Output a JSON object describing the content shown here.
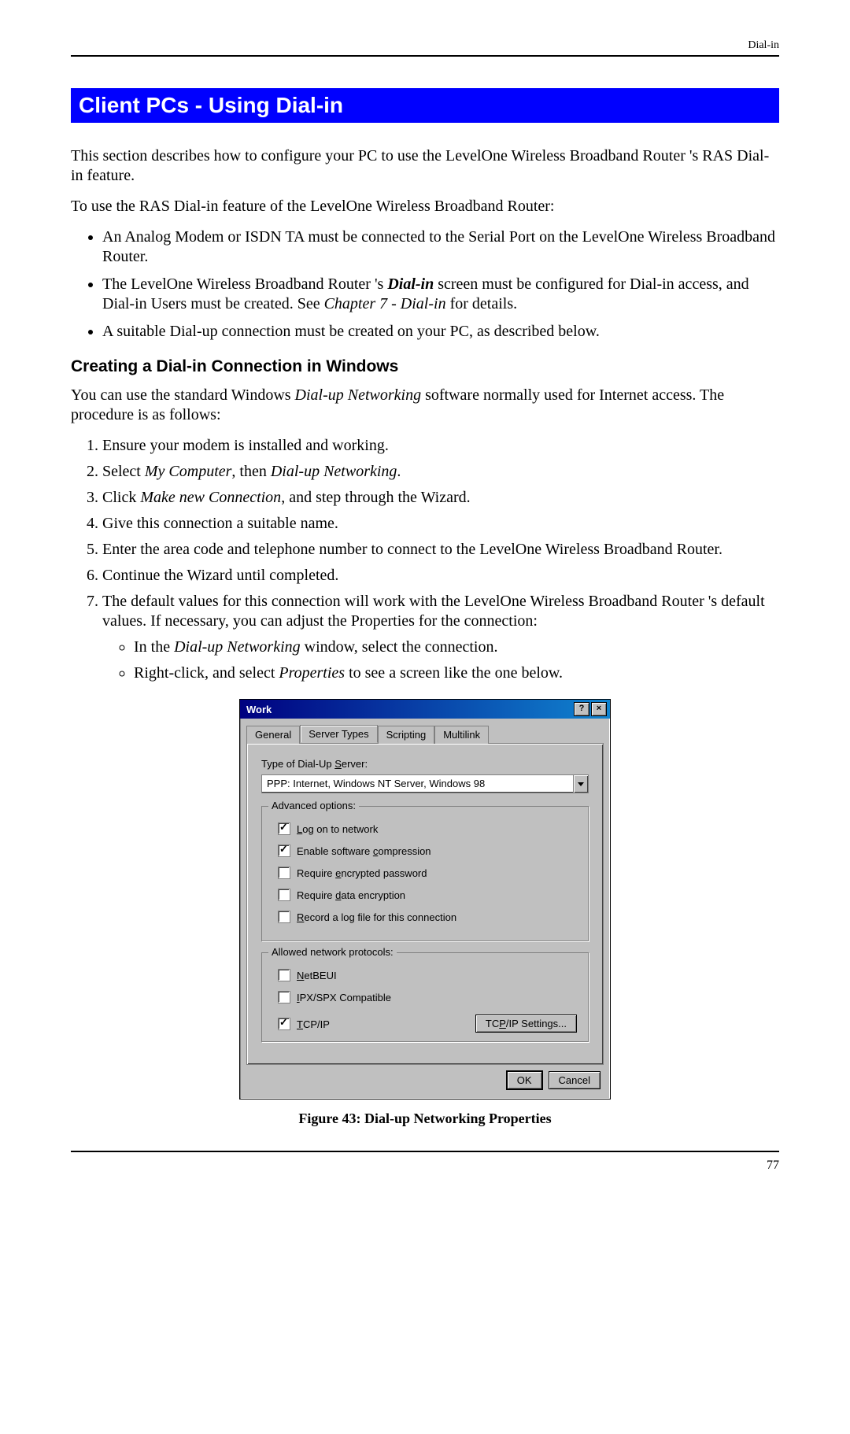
{
  "header": {
    "label": "Dial-in"
  },
  "banner": "Client PCs - Using Dial-in",
  "intro": {
    "p1": "This section describes how to configure your PC to use the LevelOne Wireless Broadband Router 's RAS Dial-in feature.",
    "p2": "To use the RAS Dial-in feature of the LevelOne Wireless Broadband Router:"
  },
  "bullets": {
    "b1": "An Analog Modem or ISDN TA must be connected to the Serial Port on the LevelOne Wireless Broadband Router.",
    "b2a": "The LevelOne Wireless Broadband Router 's ",
    "b2b": "Dial-in",
    "b2c": " screen must be configured for Dial-in access, and Dial-in Users must be created. See ",
    "b2d": "Chapter 7 - Dial-in",
    "b2e": " for details.",
    "b3": "A suitable Dial-up connection must be created on your PC, as described below."
  },
  "subheading": "Creating a Dial-in Connection in Windows",
  "subintro_a": "You can use the standard Windows ",
  "subintro_b": "Dial-up Networking",
  "subintro_c": " software normally used for Internet access. The procedure is as follows:",
  "steps": {
    "s1": "Ensure your modem is installed and working.",
    "s2a": "Select ",
    "s2b": "My Computer",
    "s2c": ", then ",
    "s2d": "Dial-up Networking",
    "s2e": ".",
    "s3a": "Click ",
    "s3b": "Make new Connection",
    "s3c": ", and step through the Wizard.",
    "s4": "Give this connection a suitable name.",
    "s5": "Enter the area code and telephone number to connect to the LevelOne Wireless Broadband Router.",
    "s6": "Continue the Wizard until completed.",
    "s7": "The default values for this connection will work with the LevelOne Wireless Broadband Router 's default values. If necessary, you can adjust the Properties for the connection:",
    "s7_sub1a": "In the ",
    "s7_sub1b": "Dial-up Networking",
    "s7_sub1c": " window, select the connection.",
    "s7_sub2a": "Right-click, and select ",
    "s7_sub2b": "Properties",
    "s7_sub2c": " to see a screen like the one below."
  },
  "dialog": {
    "title": "Work",
    "tabs": {
      "general": "General",
      "server_types": "Server Types",
      "scripting": "Scripting",
      "multilink": "Multilink"
    },
    "field_label": "Type of Dial-Up Server:",
    "combo_value": "PPP: Internet, Windows NT Server, Windows 98",
    "group_adv": "Advanced options:",
    "adv": {
      "log_on": "Log on to network",
      "compress": "Enable software compression",
      "enc_pass": "Require encrypted password",
      "enc_data": "Require data encryption",
      "record": "Record a log file for this connection"
    },
    "group_proto": "Allowed network protocols:",
    "proto": {
      "netbeui": "NetBEUI",
      "ipx": "IPX/SPX Compatible",
      "tcpip": "TCP/IP"
    },
    "tcpip_btn": "TCP/IP Settings...",
    "ok": "OK",
    "cancel": "Cancel"
  },
  "caption": "Figure 43: Dial-up Networking Properties",
  "page_number": "77"
}
